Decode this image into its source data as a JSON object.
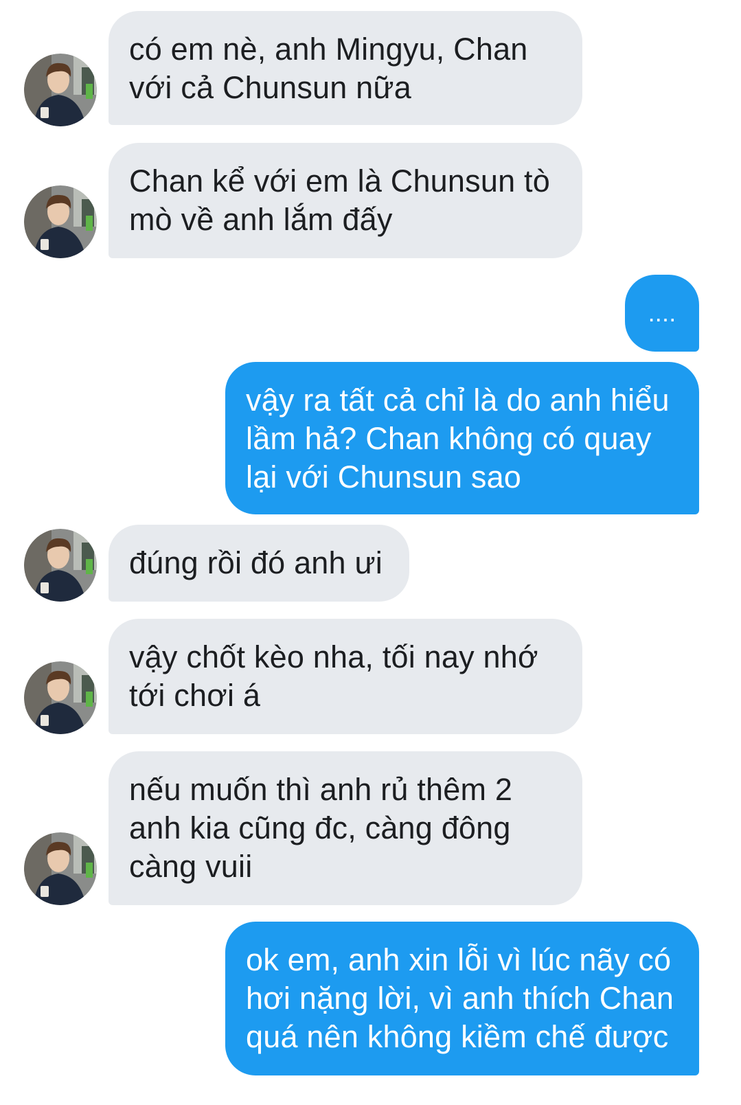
{
  "conversation": {
    "messages": [
      {
        "sender": "them",
        "text": "có em nè, anh Mingyu, Chan\nvới cả Chunsun nữa"
      },
      {
        "sender": "them",
        "text": "Chan kể với em là Chunsun tò\nmò về anh lắm đấy"
      },
      {
        "sender": "me",
        "text": "...."
      },
      {
        "sender": "me",
        "text": "vậy ra tất cả chỉ là do anh hiểu\nlầm hả? Chan không có quay\nlại với Chunsun sao"
      },
      {
        "sender": "them",
        "text": "đúng rồi đó anh ưi"
      },
      {
        "sender": "them",
        "text": "vậy chốt kèo nha, tối nay nhớ\ntới chơi á"
      },
      {
        "sender": "them",
        "text": "nếu muốn thì anh rủ thêm 2\nanh kia cũng đc, càng đông\ncàng vuii"
      },
      {
        "sender": "me",
        "text": "ok em, anh xin lỗi vì lúc nãy có\nhơi nặng lời, vì anh thích Chan\nquá nên không kiềm chế được"
      }
    ]
  },
  "colors": {
    "incoming_bubble": "#e7eaee",
    "outgoing_bubble": "#1d9bf0"
  }
}
